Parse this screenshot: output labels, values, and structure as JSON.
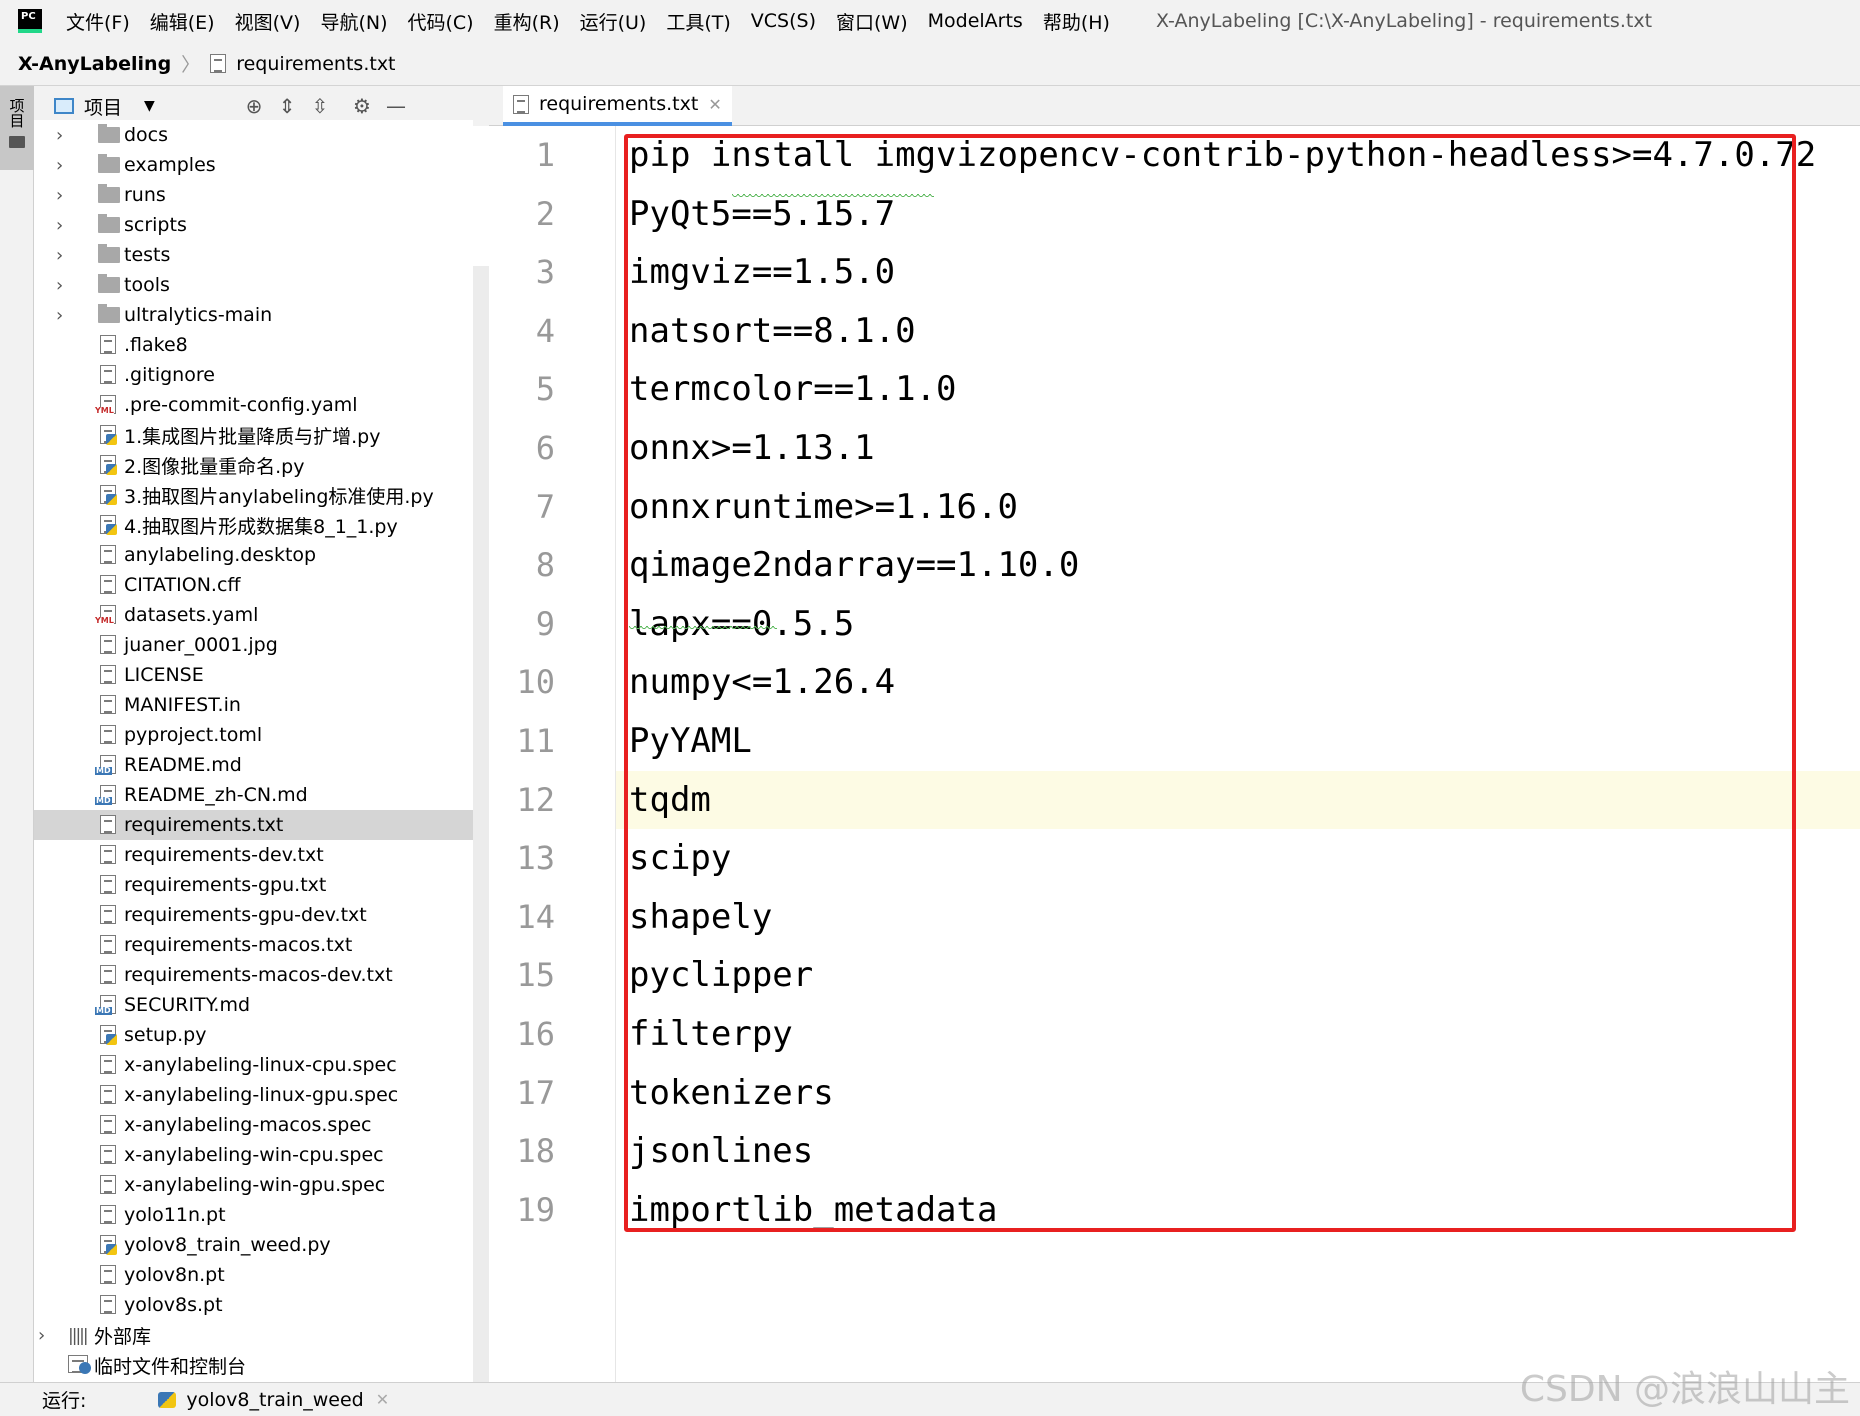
{
  "menubar": {
    "logo_text": "PC",
    "items": [
      "文件(F)",
      "编辑(E)",
      "视图(V)",
      "导航(N)",
      "代码(C)",
      "重构(R)",
      "运行(U)",
      "工具(T)",
      "VCS(S)",
      "窗口(W)",
      "ModelArts",
      "帮助(H)"
    ],
    "window_title": "X-AnyLabeling [C:\\X-AnyLabeling] - requirements.txt"
  },
  "navbar": {
    "project": "X-AnyLabeling",
    "file": "requirements.txt"
  },
  "side_strip": {
    "tab_label": "项目"
  },
  "project_panel": {
    "title": "项目",
    "toolbar_icons": [
      "locate-icon",
      "expand-all-icon",
      "collapse-all-icon",
      "gear-icon",
      "hide-icon"
    ]
  },
  "tree": {
    "folders": [
      "docs",
      "examples",
      "runs",
      "scripts",
      "tests",
      "tools",
      "ultralytics-main"
    ],
    "files": [
      {
        "name": ".flake8",
        "type": "text"
      },
      {
        "name": ".gitignore",
        "type": "ignore"
      },
      {
        "name": ".pre-commit-config.yaml",
        "type": "yaml"
      },
      {
        "name": "1.集成图片批量降质与扩增.py",
        "type": "python"
      },
      {
        "name": "2.图像批量重命名.py",
        "type": "python"
      },
      {
        "name": "3.抽取图片anylabeling标准使用.py",
        "type": "python"
      },
      {
        "name": "4.抽取图片形成数据集8_1_1.py",
        "type": "python"
      },
      {
        "name": "anylabeling.desktop",
        "type": "text"
      },
      {
        "name": "CITATION.cff",
        "type": "text"
      },
      {
        "name": "datasets.yaml",
        "type": "yaml"
      },
      {
        "name": "juaner_0001.jpg",
        "type": "image"
      },
      {
        "name": "LICENSE",
        "type": "text"
      },
      {
        "name": "MANIFEST.in",
        "type": "text"
      },
      {
        "name": "pyproject.toml",
        "type": "toml"
      },
      {
        "name": "README.md",
        "type": "markdown"
      },
      {
        "name": "README_zh-CN.md",
        "type": "markdown"
      },
      {
        "name": "requirements.txt",
        "type": "text",
        "selected": true
      },
      {
        "name": "requirements-dev.txt",
        "type": "text"
      },
      {
        "name": "requirements-gpu.txt",
        "type": "text"
      },
      {
        "name": "requirements-gpu-dev.txt",
        "type": "text"
      },
      {
        "name": "requirements-macos.txt",
        "type": "text"
      },
      {
        "name": "requirements-macos-dev.txt",
        "type": "text"
      },
      {
        "name": "SECURITY.md",
        "type": "markdown"
      },
      {
        "name": "setup.py",
        "type": "python"
      },
      {
        "name": "x-anylabeling-linux-cpu.spec",
        "type": "text"
      },
      {
        "name": "x-anylabeling-linux-gpu.spec",
        "type": "text"
      },
      {
        "name": "x-anylabeling-macos.spec",
        "type": "text"
      },
      {
        "name": "x-anylabeling-win-cpu.spec",
        "type": "text"
      },
      {
        "name": "x-anylabeling-win-gpu.spec",
        "type": "text"
      },
      {
        "name": "yolo11n.pt",
        "type": "text"
      },
      {
        "name": "yolov8_train_weed.py",
        "type": "python"
      },
      {
        "name": "yolov8n.pt",
        "type": "text"
      },
      {
        "name": "yolov8s.pt",
        "type": "text"
      }
    ],
    "external_libs": "外部库",
    "scratches": "临时文件和控制台"
  },
  "editor": {
    "tab_label": "requirements.txt",
    "current_line": 12,
    "lines": [
      "pip install imgvizopencv-contrib-python-headless>=4.7.0.72",
      "PyQt5==5.15.7",
      "imgviz==1.5.0",
      "natsort==8.1.0",
      "termcolor==1.1.0",
      "onnx>=1.13.1",
      "onnxruntime>=1.16.0",
      "qimage2ndarray==1.10.0",
      "lapx==0.5.5",
      "numpy<=1.26.4",
      "PyYAML",
      "tqdm",
      "scipy",
      "shapely",
      "pyclipper",
      "filterpy",
      "tokenizers",
      "jsonlines",
      "importlib_metadata"
    ],
    "highlight_color": "#e82020"
  },
  "bottom_bar": {
    "run_label": "运行:",
    "run_config": "yolov8_train_weed"
  },
  "watermark": "CSDN @浪浪山山主"
}
